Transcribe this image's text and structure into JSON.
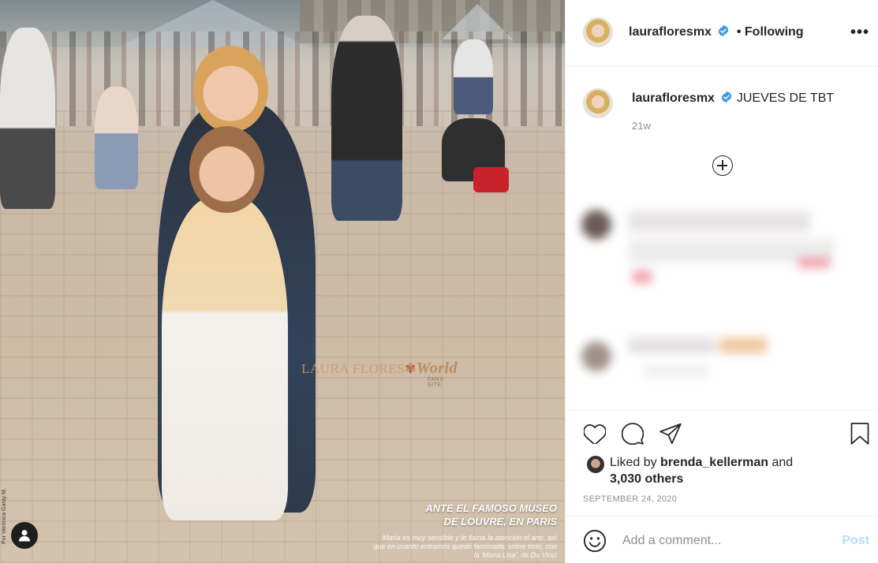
{
  "post": {
    "image_alt": "",
    "watermark_brand": "LAURA FLORES",
    "watermark_world": "World",
    "watermark_fans": "FANS SITE",
    "caption_title_line1": "ANTE EL FAMOSO MUSEO",
    "caption_title_line2": "DE LOUVRE, EN PARIS",
    "caption_body": "María es muy sensible y le llama la atención el arte, así que en cuanto entramos quedó fascinada, sobre todo, con la 'Mona Lisa', de Da Vinci",
    "photo_credit": "Por Verónica Garay M."
  },
  "header": {
    "username": "laurafloresmx",
    "separator": "•",
    "follow_status": "Following",
    "more_icon": "more-options-icon"
  },
  "caption_comment": {
    "username": "laurafloresmx",
    "text": "JUEVES DE TBT",
    "time": "21w"
  },
  "likes": {
    "liked_by_prefix": "Liked by",
    "liked_by_user": "brenda_kellerman",
    "and_text": "and",
    "others": "3,030 others"
  },
  "date": "SEPTEMBER 24, 2020",
  "comment_box": {
    "placeholder": "Add a comment...",
    "post_label": "Post"
  },
  "colors": {
    "verified": "#3897f0",
    "post_disabled": "#b2dffc",
    "secondary_text": "#8e8e8e"
  }
}
